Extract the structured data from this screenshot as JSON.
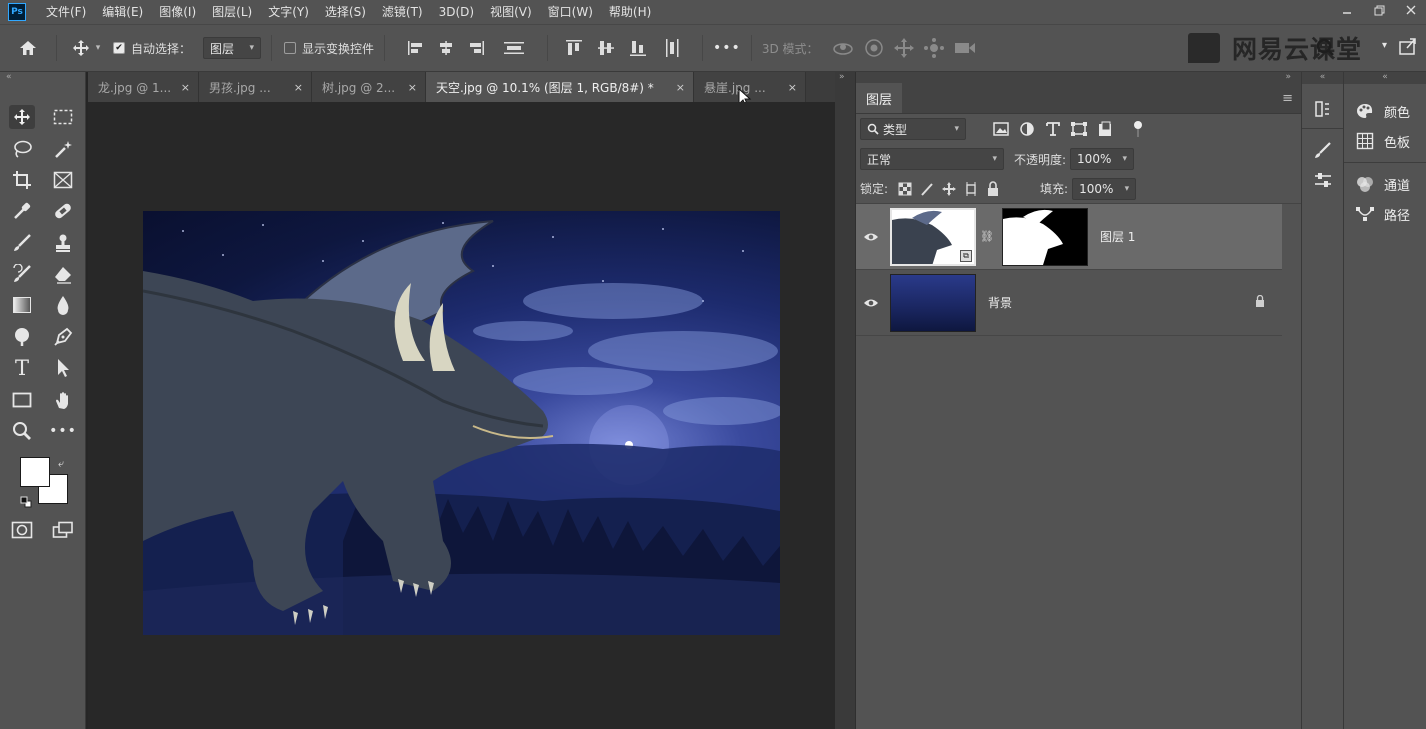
{
  "app": {
    "logo_text": "Ps"
  },
  "menu": [
    "文件(F)",
    "编辑(E)",
    "图像(I)",
    "图层(L)",
    "文字(Y)",
    "选择(S)",
    "滤镜(T)",
    "3D(D)",
    "视图(V)",
    "窗口(W)",
    "帮助(H)"
  ],
  "options": {
    "auto_select_label": "自动选择：",
    "auto_select_target": "图层",
    "show_transform_label": "显示变换控件",
    "mode_3d_label": "3D 模式：",
    "more": "•••"
  },
  "watermark": {
    "text": "网易云课堂"
  },
  "tabs": [
    {
      "label": "龙.jpg @ 1...",
      "close": "×",
      "active": false
    },
    {
      "label": "男孩.jpg ...",
      "close": "×",
      "active": false
    },
    {
      "label": "树.jpg @ 2...",
      "close": "×",
      "active": false
    },
    {
      "label": "天空.jpg @ 10.1% (图层 1, RGB/8#) *",
      "close": "×",
      "active": true
    },
    {
      "label": "悬崖.jpg ...",
      "close": "×",
      "active": false
    }
  ],
  "layers_panel": {
    "tab_label": "图层",
    "filter_kind": "类型",
    "blend_mode": "正常",
    "opacity_label": "不透明度:",
    "opacity_value": "100%",
    "lock_label": "锁定:",
    "fill_label": "填充:",
    "fill_value": "100%",
    "layers": [
      {
        "name": "图层 1",
        "selected": true,
        "has_mask": true
      },
      {
        "name": "背景",
        "selected": false,
        "locked": true
      }
    ]
  },
  "side_panels": [
    {
      "label": "颜色",
      "icon": "palette-icon"
    },
    {
      "label": "色板",
      "icon": "swatches-icon"
    },
    {
      "label": "通道",
      "icon": "channels-icon"
    },
    {
      "label": "路径",
      "icon": "paths-icon"
    }
  ],
  "colors": {
    "accent": "#31a8ff",
    "chrome": "#535353",
    "canvas_bg": "#282828"
  }
}
